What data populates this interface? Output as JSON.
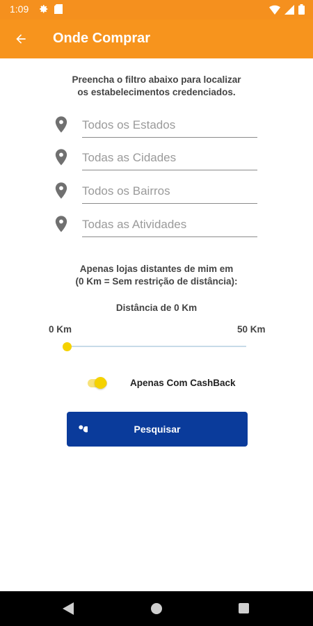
{
  "status_bar": {
    "time": "1:09",
    "left_icons": [
      "settings-icon",
      "sd-card-icon"
    ],
    "right_icons": [
      "wifi-icon",
      "signal-icon",
      "battery-icon"
    ]
  },
  "app_bar": {
    "title": "Onde Comprar",
    "back_icon": "arrow-back-icon",
    "background": "#f7941d"
  },
  "intro_text": {
    "line1": "Preencha o filtro abaixo para localizar",
    "line2": "os estabelecimentos credenciados."
  },
  "filters": {
    "icon": "location-pin-icon",
    "estado_placeholder": "Todos os Estados",
    "cidade_placeholder": "Todas as Cidades",
    "bairro_placeholder": "Todos os Bairros",
    "atividade_placeholder": "Todas as Atividades"
  },
  "distance": {
    "line1": "Apenas lojas distantes de mim em",
    "line2": "(0 Km = Sem restrição de distância):",
    "current_label": "Distância de 0 Km",
    "min_label": "0 Km",
    "max_label": "50 Km",
    "value_km": 0
  },
  "cashback": {
    "label": "Apenas Com CashBack",
    "enabled": true
  },
  "search_button": {
    "label": "Pesquisar",
    "icon": "search-icon",
    "color": "#0a3b9b"
  },
  "nav_bar": {
    "icons": [
      "nav-back-icon",
      "nav-home-icon",
      "nav-recents-icon"
    ]
  },
  "colors": {
    "accent": "#f7941d",
    "toggle": "#f5d200"
  }
}
